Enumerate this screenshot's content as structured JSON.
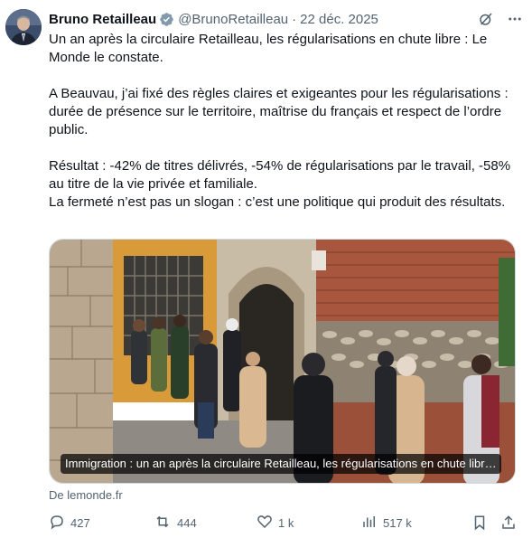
{
  "tweet": {
    "author_name": "Bruno Retailleau",
    "handle": "@BrunoRetailleau",
    "separator": "·",
    "date": "22 déc. 2025",
    "paragraphs": [
      "Un an après la circulaire Retailleau, les régularisations en chute libre : Le Monde le constate.",
      "A Beauvau, j’ai fixé des règles claires et exigeantes pour les régularisations : durée de présence sur le territoire, maîtrise du français et respect de l’ordre public.",
      "Résultat : -42% de titres délivrés, -54% de régularisations par le travail, -58% au titre de la vie privée et familiale.",
      "La fermeté n’est pas un slogan : c’est une politique qui produit des résultats."
    ],
    "media_caption": "Immigration : un an après la circulaire Retailleau, les régularisations en chute libre : Le Monde le constate",
    "source": "De lemonde.fr",
    "stats": {
      "replies": "427",
      "reposts": "444",
      "likes": "1 k",
      "views": "517 k"
    },
    "colors": {
      "text": "#0f1419",
      "secondary": "#536471",
      "verified": "#829aab"
    },
    "icons": [
      "verified-badge-icon",
      "grok-icon",
      "more-icon",
      "reply-icon",
      "repost-icon",
      "like-icon",
      "views-icon",
      "bookmark-icon",
      "share-icon"
    ]
  }
}
